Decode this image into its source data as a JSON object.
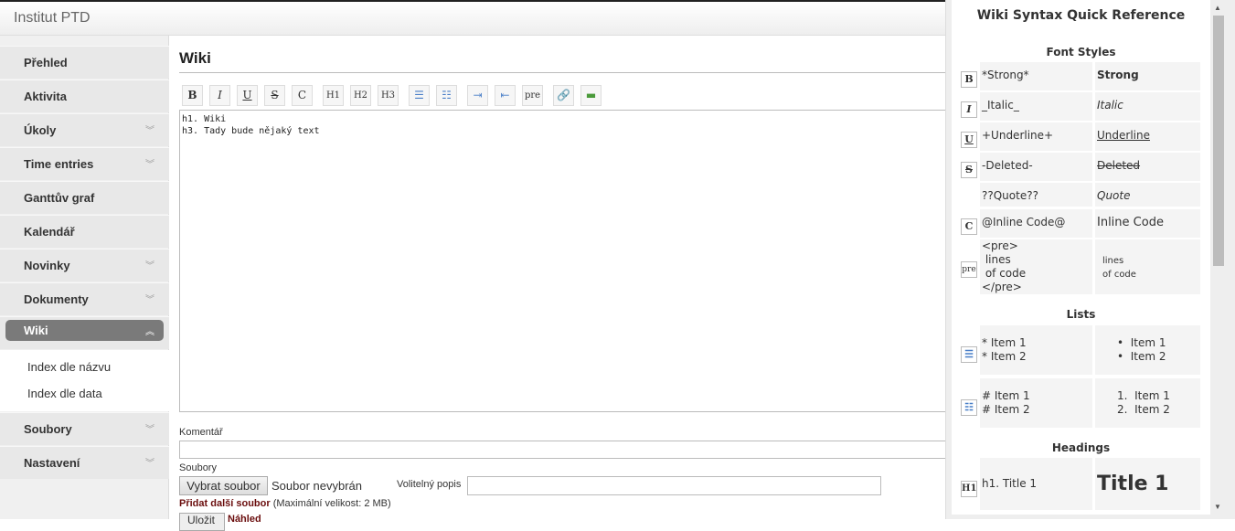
{
  "app_title": "Institut PTD",
  "sidebar": {
    "items": [
      {
        "label": "Přehled",
        "chev": false
      },
      {
        "label": "Aktivita",
        "chev": false
      },
      {
        "label": "Úkoly",
        "chev": true
      },
      {
        "label": "Time entries",
        "chev": true
      },
      {
        "label": "Ganttův graf",
        "chev": false
      },
      {
        "label": "Kalendář",
        "chev": false
      },
      {
        "label": "Novinky",
        "chev": true
      },
      {
        "label": "Dokumenty",
        "chev": true
      },
      {
        "label": "Wiki",
        "chev": true
      },
      {
        "label": "Soubory",
        "chev": true
      },
      {
        "label": "Nastavení",
        "chev": true
      }
    ],
    "subitems": [
      "Index dle názvu",
      "Index dle data"
    ]
  },
  "main": {
    "title": "Wiki",
    "toolbar": [
      {
        "name": "bold",
        "label": "B"
      },
      {
        "name": "italic",
        "label": "I"
      },
      {
        "name": "underline",
        "label": "U"
      },
      {
        "name": "strike",
        "label": "S"
      },
      {
        "name": "code",
        "label": "C"
      },
      {
        "name": "h1",
        "label": "H1"
      },
      {
        "name": "h2",
        "label": "H2"
      },
      {
        "name": "h3",
        "label": "H3"
      },
      {
        "name": "ul",
        "label": "☰"
      },
      {
        "name": "ol",
        "label": "☷"
      },
      {
        "name": "indent",
        "label": "⇥"
      },
      {
        "name": "outdent",
        "label": "⇤"
      },
      {
        "name": "pre",
        "label": "pre"
      },
      {
        "name": "link",
        "label": "🔗"
      },
      {
        "name": "image",
        "label": "▬"
      }
    ],
    "editor_text": "h1. Wiki\nh3. Tady bude nějaký text",
    "comment_label": "Komentář",
    "files_label": "Soubory",
    "choose_file": "Vybrat soubor",
    "no_file": "Soubor nevybrán",
    "desc_label": "Volitelný popis",
    "add_file": "Přidat další soubor",
    "max_size": "(Maximální velikost: 2 MB)",
    "save": "Uložit",
    "preview": "Náhled"
  },
  "panel": {
    "title": "Wiki Syntax Quick Reference",
    "font_styles": "Font Styles",
    "lists": "Lists",
    "headings": "Headings",
    "rows": [
      {
        "icon": "B",
        "src": "*Strong*",
        "out": "Strong"
      },
      {
        "icon": "I",
        "src": "_Italic_",
        "out": "Italic"
      },
      {
        "icon": "U",
        "src": "+Underline+",
        "out": "Underline"
      },
      {
        "icon": "S",
        "src": "-Deleted-",
        "out": "Deleted"
      },
      {
        "icon": "",
        "src": "??Quote??",
        "out": "Quote"
      },
      {
        "icon": "C",
        "src": "@Inline Code@",
        "out": "Inline Code"
      },
      {
        "icon": "pre",
        "src": "<pre>\n lines\n of code\n</pre>",
        "out": "lines\nof code"
      }
    ],
    "list_rows": [
      {
        "src": "* Item 1\n* Item 2",
        "out": "•  Item 1\n•  Item 2"
      },
      {
        "src": "# Item 1\n# Item 2",
        "out": "1.  Item 1\n2.  Item 2"
      }
    ],
    "heading_row": {
      "icon": "H1",
      "src": "h1. Title 1",
      "out": "Title 1"
    }
  }
}
